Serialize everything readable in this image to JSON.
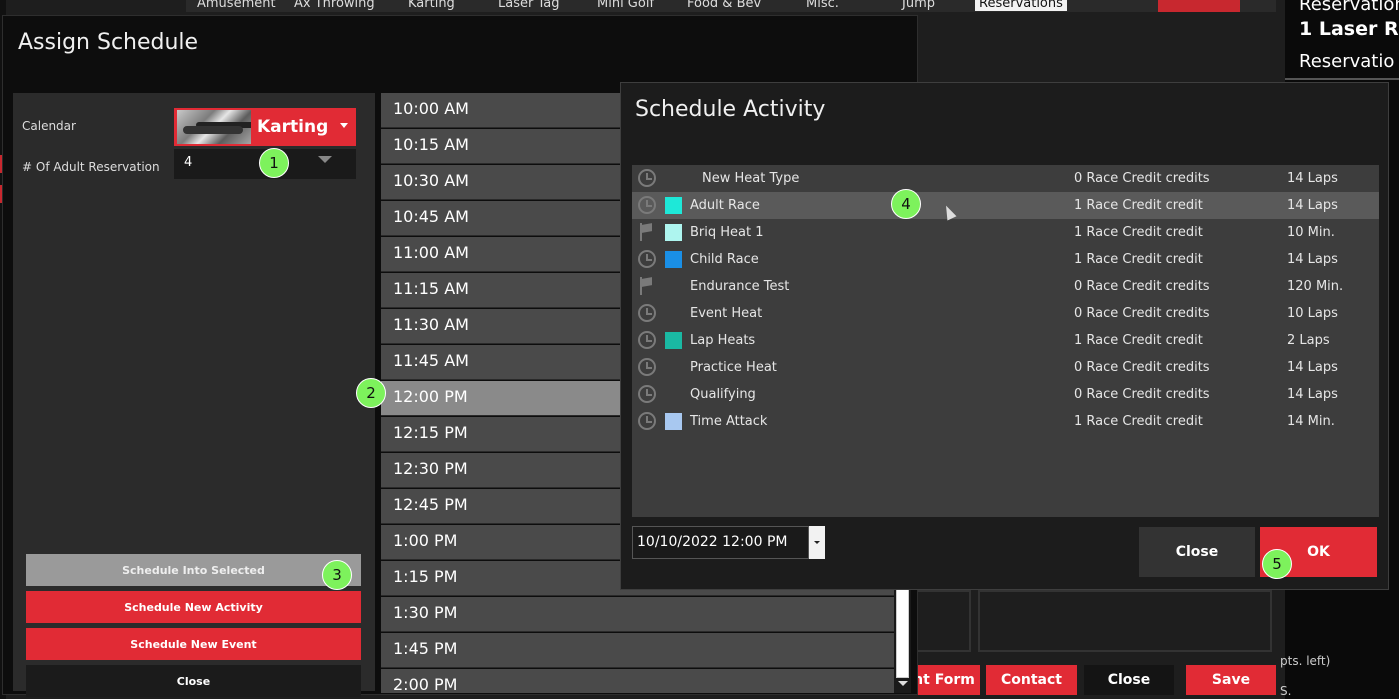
{
  "background": {
    "tabs": [
      {
        "label": "Amusement",
        "active": false
      },
      {
        "label": "Ax Throwing",
        "active": false
      },
      {
        "label": "Karting",
        "active": false
      },
      {
        "label": "Laser Tag",
        "active": false
      },
      {
        "label": "Mini Golf",
        "active": false
      },
      {
        "label": "Food & Bev",
        "active": false
      },
      {
        "label": "Misc.",
        "active": false
      },
      {
        "label": "Jump",
        "active": false
      },
      {
        "label": "Reservations",
        "active": true
      }
    ],
    "right_lines": [
      "Reservations",
      "1 Laser Re",
      "Reservatio",
      "pts. left)",
      "S."
    ],
    "bottom_buttons": [
      "nt Form",
      "Contact",
      "Close",
      "Save"
    ]
  },
  "assign": {
    "title": "Assign Schedule",
    "calendar_label": "Calendar",
    "calendar_value": "Karting",
    "adult_label": "# Of Adult Reservation",
    "adult_value": "4",
    "buttons": {
      "into_selected": "Schedule Into Selected",
      "new_activity": "Schedule New Activity",
      "new_event": "Schedule New Event",
      "close": "Close"
    },
    "times": [
      "10:00 AM",
      "10:15 AM",
      "10:30 AM",
      "10:45 AM",
      "11:00 AM",
      "11:15 AM",
      "11:30 AM",
      "11:45 AM",
      "12:00 PM",
      "12:15 PM",
      "12:30 PM",
      "12:45 PM",
      "1:00 PM",
      "1:15 PM",
      "1:30 PM",
      "1:45 PM",
      "2:00 PM"
    ],
    "selected_time": "12:00 PM"
  },
  "activity": {
    "title": "Schedule Activity",
    "rows": [
      {
        "icon": "clock",
        "color": "",
        "name": "New Heat Type",
        "credit": "0 Race Credit credits",
        "length": "14 Laps"
      },
      {
        "icon": "clock",
        "color": "#1ee8d8",
        "name": "Adult Race",
        "credit": "1 Race Credit credit",
        "length": "14 Laps",
        "highlight": true
      },
      {
        "icon": "flag",
        "color": "#aef5ef",
        "name": "Briq Heat 1",
        "credit": "1 Race Credit credit",
        "length": "10 Min."
      },
      {
        "icon": "clock",
        "color": "#1a8fe6",
        "name": "Child Race",
        "credit": "1 Race Credit credit",
        "length": "14 Laps"
      },
      {
        "icon": "flag",
        "color": "",
        "name": "Endurance Test",
        "credit": "0 Race Credit credits",
        "length": "120 Min."
      },
      {
        "icon": "clock",
        "color": "",
        "name": "Event Heat",
        "credit": "0 Race Credit credits",
        "length": "10 Laps"
      },
      {
        "icon": "clock",
        "color": "#1ab9a3",
        "name": "Lap Heats",
        "credit": "1 Race Credit credit",
        "length": "2 Laps"
      },
      {
        "icon": "clock",
        "color": "",
        "name": "Practice Heat",
        "credit": "0 Race Credit credits",
        "length": "14 Laps"
      },
      {
        "icon": "clock",
        "color": "",
        "name": "Qualifying",
        "credit": "0 Race Credit credits",
        "length": "14 Laps"
      },
      {
        "icon": "clock",
        "color": "#a8c8f0",
        "name": "Time Attack",
        "credit": "1 Race Credit credit",
        "length": "14 Min."
      }
    ],
    "datetime": "10/10/2022 12:00 PM",
    "close_label": "Close",
    "ok_label": "OK"
  },
  "badges": [
    "1",
    "2",
    "3",
    "4",
    "5"
  ]
}
